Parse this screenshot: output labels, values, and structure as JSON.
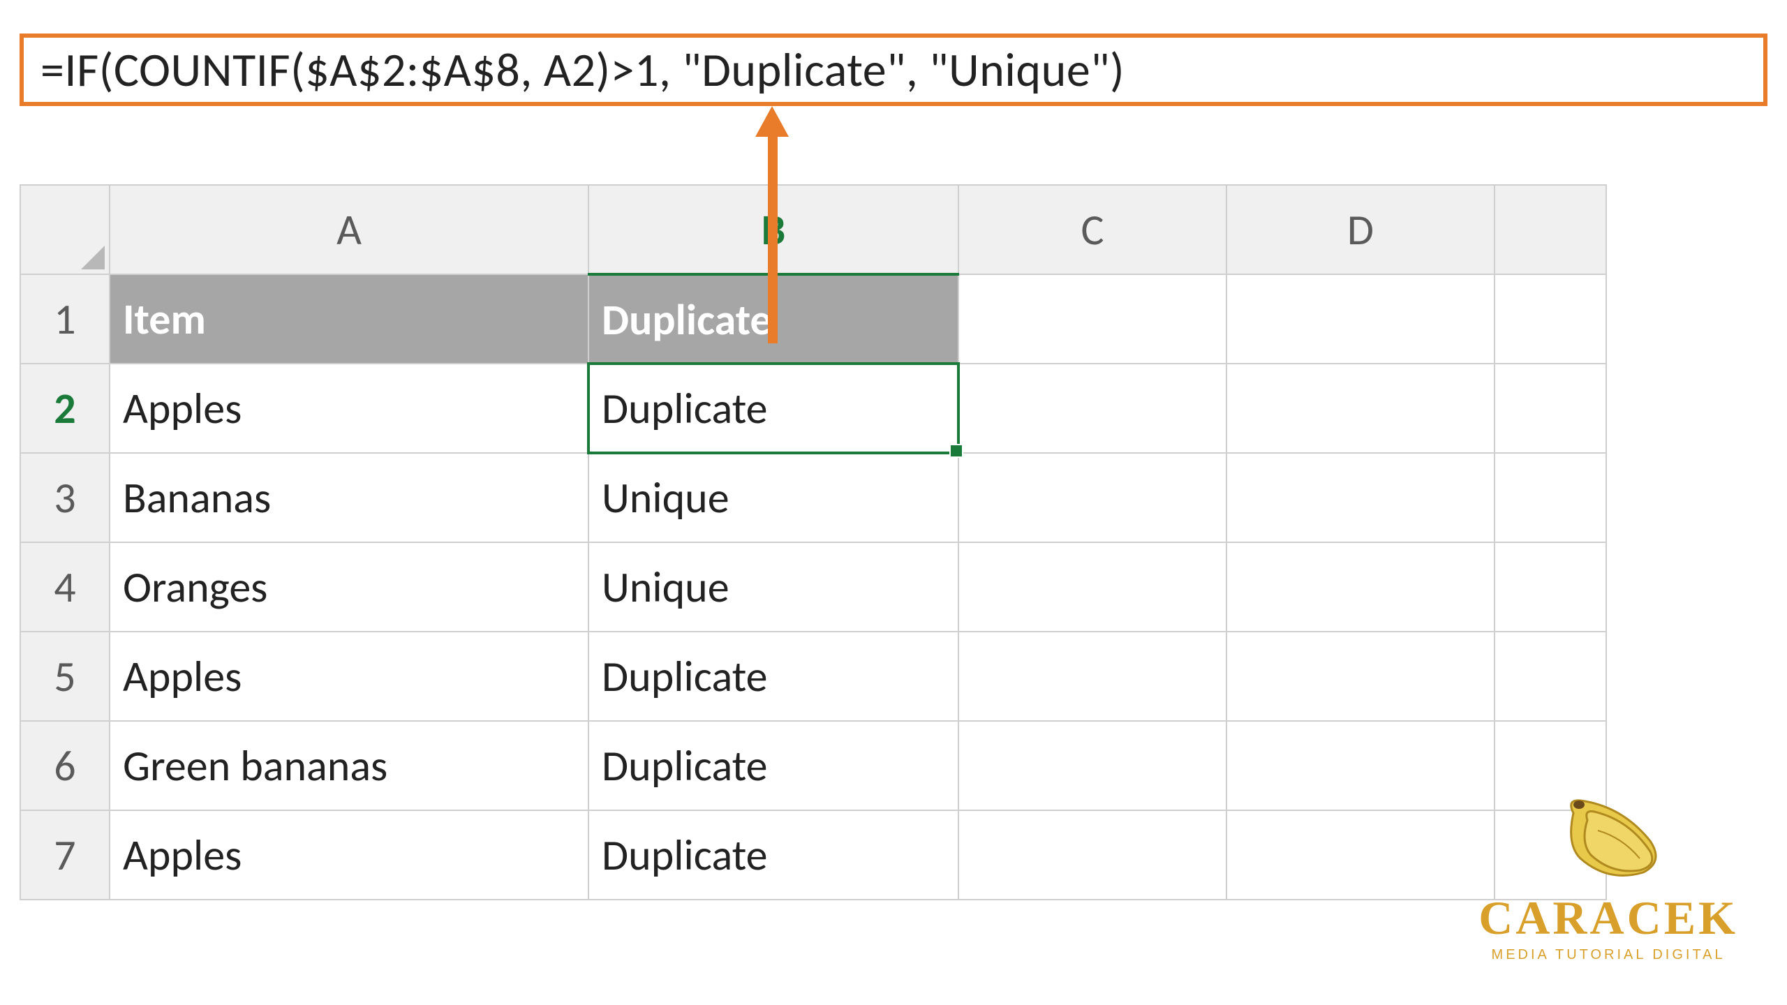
{
  "formula": "=IF(COUNTIF($A$2:$A$8, A2)>1, \"Duplicate\", \"Unique\")",
  "columns": [
    "A",
    "B",
    "C",
    "D"
  ],
  "active_column": "B",
  "active_row": "2",
  "rows": [
    "1",
    "2",
    "3",
    "4",
    "5",
    "6",
    "7"
  ],
  "headers": {
    "A": "Item",
    "B": "Duplicate"
  },
  "data": [
    {
      "A": "Apples",
      "B": "Duplicate"
    },
    {
      "A": "Bananas",
      "B": "Unique"
    },
    {
      "A": "Oranges",
      "B": "Unique"
    },
    {
      "A": "Apples",
      "B": "Duplicate"
    },
    {
      "A": "Green bananas",
      "B": "Duplicate"
    },
    {
      "A": "Apples",
      "B": "Duplicate"
    }
  ],
  "logo": {
    "name": "CARACEK",
    "tagline": "MEDIA TUTORIAL DIGITAL"
  }
}
